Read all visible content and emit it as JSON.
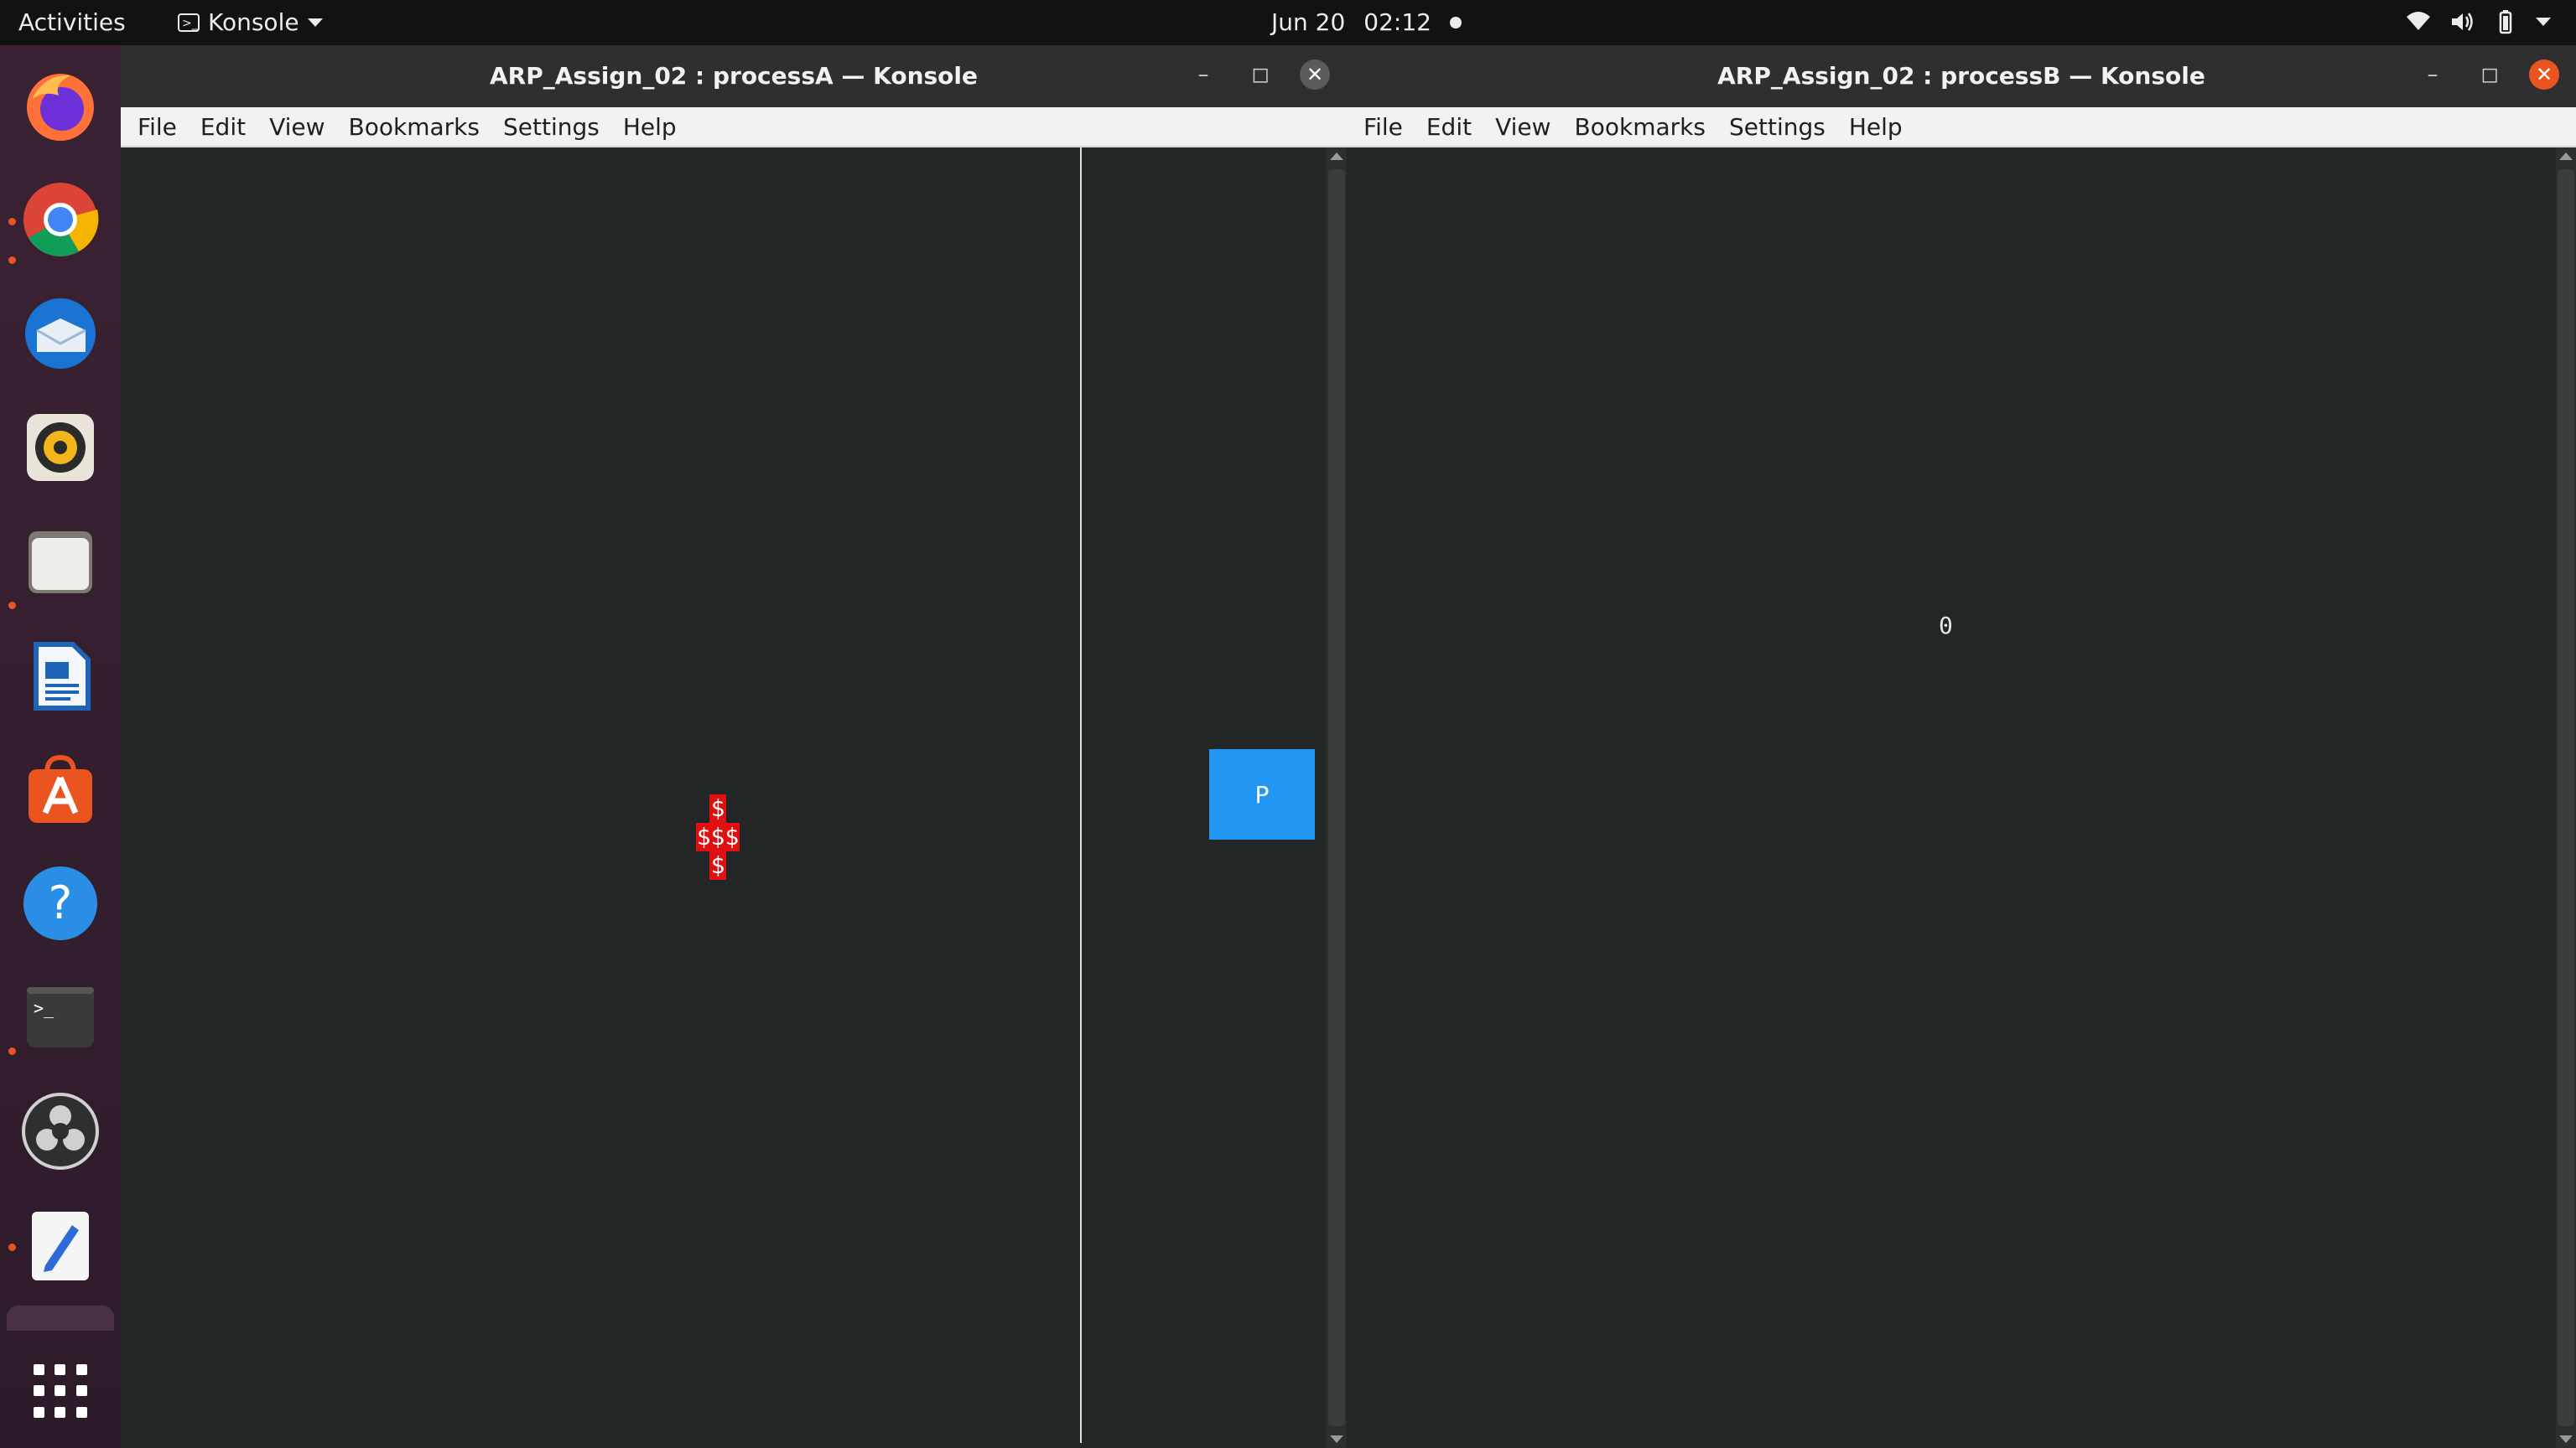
{
  "topbar": {
    "activities": "Activities",
    "app_name": "Konsole",
    "date": "Jun 20",
    "time": "02:12"
  },
  "dock": {
    "items": [
      "firefox-icon",
      "chrome-icon",
      "thunderbird-icon",
      "rhythmbox-icon",
      "files-icon",
      "writer-icon",
      "software-icon",
      "help-icon",
      "terminal-icon",
      "obs-icon",
      "text-editor-icon"
    ],
    "show_apps": "show-applications-icon"
  },
  "windowA": {
    "title": "ARP_Assign_02 : processA — Konsole",
    "menu": [
      "File",
      "Edit",
      "View",
      "Bookmarks",
      "Settings",
      "Help"
    ],
    "cross": [
      "$",
      "$$$",
      "$"
    ],
    "target_label": "P"
  },
  "windowB": {
    "title": "ARP_Assign_02 : processB — Konsole",
    "menu": [
      "File",
      "Edit",
      "View",
      "Bookmarks",
      "Settings",
      "Help"
    ],
    "value": "0"
  },
  "colors": {
    "accent": "#e95420",
    "terminal_bg": "#222627",
    "target_blue": "#2196f3",
    "marker_red": "#e01010"
  }
}
